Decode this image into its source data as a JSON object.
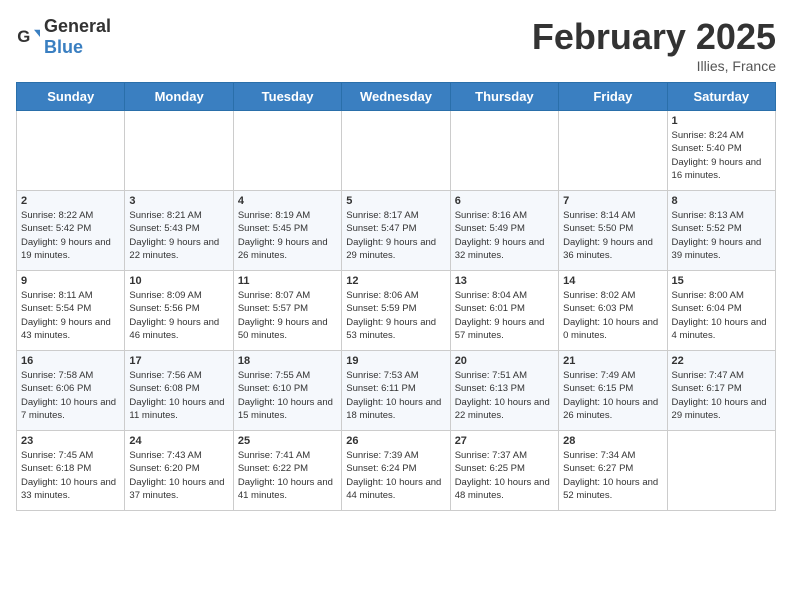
{
  "header": {
    "logo_general": "General",
    "logo_blue": "Blue",
    "title": "February 2025",
    "subtitle": "Illies, France"
  },
  "days_of_week": [
    "Sunday",
    "Monday",
    "Tuesday",
    "Wednesday",
    "Thursday",
    "Friday",
    "Saturday"
  ],
  "weeks": [
    [
      {
        "day": "",
        "info": ""
      },
      {
        "day": "",
        "info": ""
      },
      {
        "day": "",
        "info": ""
      },
      {
        "day": "",
        "info": ""
      },
      {
        "day": "",
        "info": ""
      },
      {
        "day": "",
        "info": ""
      },
      {
        "day": "1",
        "info": "Sunrise: 8:24 AM\nSunset: 5:40 PM\nDaylight: 9 hours and 16 minutes."
      }
    ],
    [
      {
        "day": "2",
        "info": "Sunrise: 8:22 AM\nSunset: 5:42 PM\nDaylight: 9 hours and 19 minutes."
      },
      {
        "day": "3",
        "info": "Sunrise: 8:21 AM\nSunset: 5:43 PM\nDaylight: 9 hours and 22 minutes."
      },
      {
        "day": "4",
        "info": "Sunrise: 8:19 AM\nSunset: 5:45 PM\nDaylight: 9 hours and 26 minutes."
      },
      {
        "day": "5",
        "info": "Sunrise: 8:17 AM\nSunset: 5:47 PM\nDaylight: 9 hours and 29 minutes."
      },
      {
        "day": "6",
        "info": "Sunrise: 8:16 AM\nSunset: 5:49 PM\nDaylight: 9 hours and 32 minutes."
      },
      {
        "day": "7",
        "info": "Sunrise: 8:14 AM\nSunset: 5:50 PM\nDaylight: 9 hours and 36 minutes."
      },
      {
        "day": "8",
        "info": "Sunrise: 8:13 AM\nSunset: 5:52 PM\nDaylight: 9 hours and 39 minutes."
      }
    ],
    [
      {
        "day": "9",
        "info": "Sunrise: 8:11 AM\nSunset: 5:54 PM\nDaylight: 9 hours and 43 minutes."
      },
      {
        "day": "10",
        "info": "Sunrise: 8:09 AM\nSunset: 5:56 PM\nDaylight: 9 hours and 46 minutes."
      },
      {
        "day": "11",
        "info": "Sunrise: 8:07 AM\nSunset: 5:57 PM\nDaylight: 9 hours and 50 minutes."
      },
      {
        "day": "12",
        "info": "Sunrise: 8:06 AM\nSunset: 5:59 PM\nDaylight: 9 hours and 53 minutes."
      },
      {
        "day": "13",
        "info": "Sunrise: 8:04 AM\nSunset: 6:01 PM\nDaylight: 9 hours and 57 minutes."
      },
      {
        "day": "14",
        "info": "Sunrise: 8:02 AM\nSunset: 6:03 PM\nDaylight: 10 hours and 0 minutes."
      },
      {
        "day": "15",
        "info": "Sunrise: 8:00 AM\nSunset: 6:04 PM\nDaylight: 10 hours and 4 minutes."
      }
    ],
    [
      {
        "day": "16",
        "info": "Sunrise: 7:58 AM\nSunset: 6:06 PM\nDaylight: 10 hours and 7 minutes."
      },
      {
        "day": "17",
        "info": "Sunrise: 7:56 AM\nSunset: 6:08 PM\nDaylight: 10 hours and 11 minutes."
      },
      {
        "day": "18",
        "info": "Sunrise: 7:55 AM\nSunset: 6:10 PM\nDaylight: 10 hours and 15 minutes."
      },
      {
        "day": "19",
        "info": "Sunrise: 7:53 AM\nSunset: 6:11 PM\nDaylight: 10 hours and 18 minutes."
      },
      {
        "day": "20",
        "info": "Sunrise: 7:51 AM\nSunset: 6:13 PM\nDaylight: 10 hours and 22 minutes."
      },
      {
        "day": "21",
        "info": "Sunrise: 7:49 AM\nSunset: 6:15 PM\nDaylight: 10 hours and 26 minutes."
      },
      {
        "day": "22",
        "info": "Sunrise: 7:47 AM\nSunset: 6:17 PM\nDaylight: 10 hours and 29 minutes."
      }
    ],
    [
      {
        "day": "23",
        "info": "Sunrise: 7:45 AM\nSunset: 6:18 PM\nDaylight: 10 hours and 33 minutes."
      },
      {
        "day": "24",
        "info": "Sunrise: 7:43 AM\nSunset: 6:20 PM\nDaylight: 10 hours and 37 minutes."
      },
      {
        "day": "25",
        "info": "Sunrise: 7:41 AM\nSunset: 6:22 PM\nDaylight: 10 hours and 41 minutes."
      },
      {
        "day": "26",
        "info": "Sunrise: 7:39 AM\nSunset: 6:24 PM\nDaylight: 10 hours and 44 minutes."
      },
      {
        "day": "27",
        "info": "Sunrise: 7:37 AM\nSunset: 6:25 PM\nDaylight: 10 hours and 48 minutes."
      },
      {
        "day": "28",
        "info": "Sunrise: 7:34 AM\nSunset: 6:27 PM\nDaylight: 10 hours and 52 minutes."
      },
      {
        "day": "",
        "info": ""
      }
    ]
  ]
}
